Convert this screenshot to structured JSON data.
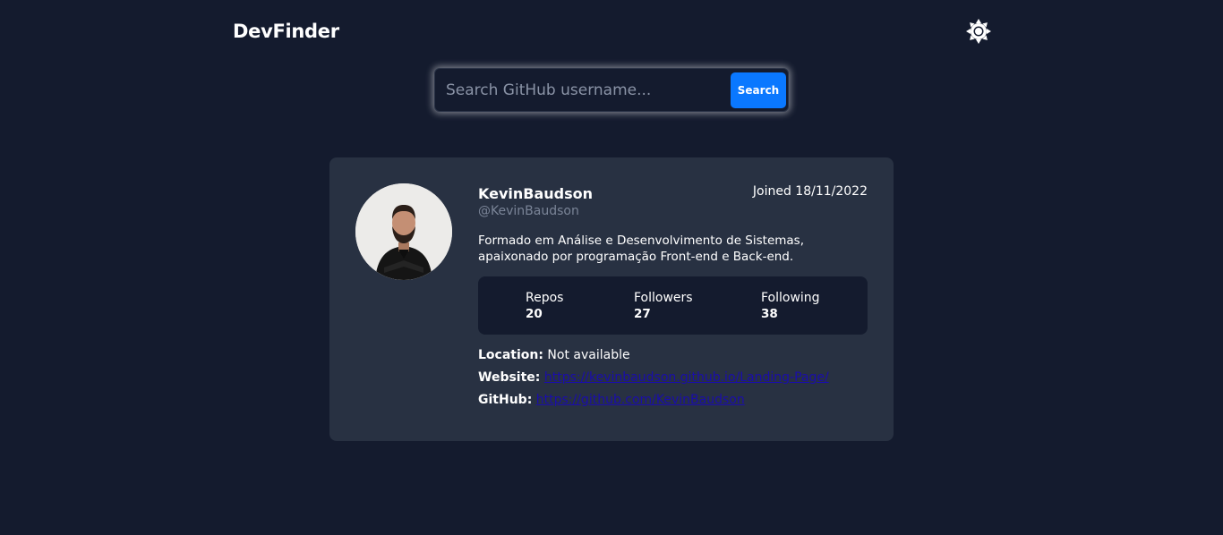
{
  "header": {
    "logo": "DevFinder",
    "theme_toggle_icon": "sun-icon"
  },
  "search": {
    "placeholder": "Search GitHub username...",
    "value": "",
    "button_label": "Search"
  },
  "profile": {
    "name": "KevinBaudson",
    "login": "@KevinBaudson",
    "joined": "Joined 18/11/2022",
    "bio_line1": "Formado em Análise e Desenvolvimento de Sistemas,",
    "bio_line2": "apaixonado por programação Front-end e Back-end.",
    "stats": [
      {
        "label": "Repos",
        "value": "20"
      },
      {
        "label": "Followers",
        "value": "27"
      },
      {
        "label": "Following",
        "value": "38"
      }
    ],
    "location_label": "Location:",
    "location_value": "Not available",
    "website_label": "Website:",
    "website_url": "https://kevinbaudson.github.io/Landing-Page/",
    "github_label": "GitHub:",
    "github_url": "https://github.com/KevinBaudson"
  },
  "colors": {
    "background": "#141b2e",
    "card": "#283142",
    "accent": "#0a78ff",
    "link": "#1a0dab",
    "muted": "#7a8497"
  }
}
